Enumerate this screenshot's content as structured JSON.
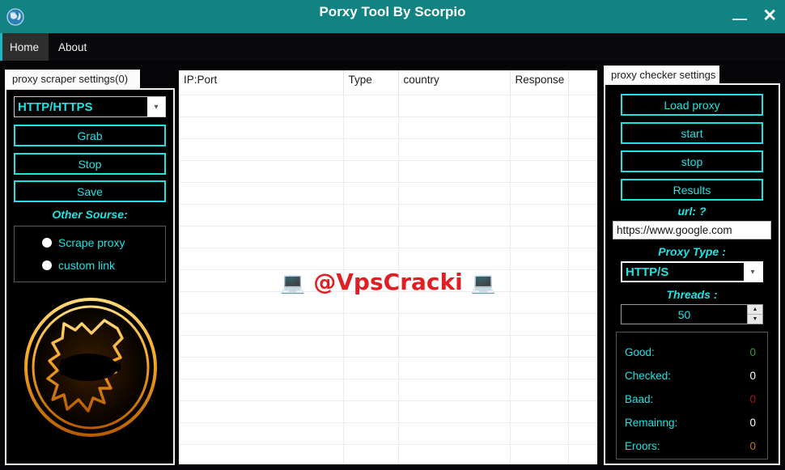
{
  "window": {
    "title": "Porxy Tool By Scorpio",
    "icon": "globe-icon",
    "minimize_label": "—",
    "close_label": "✕",
    "titlebar_color": "#118383"
  },
  "menubar": {
    "items": [
      {
        "label": "Home",
        "active": true
      },
      {
        "label": "About",
        "active": false
      }
    ]
  },
  "scraper_panel": {
    "tab_label": "proxy scraper settings(0)",
    "proxy_type_selected": "HTTP/HTTPS",
    "dropdown_icon": "chevron-down-icon",
    "buttons": [
      {
        "label": "Grab"
      },
      {
        "label": "Stop"
      },
      {
        "label": "Save"
      }
    ],
    "other_source_label": "Other Sourse:",
    "radios": [
      {
        "label": "Scrape proxy"
      },
      {
        "label": "custom link"
      }
    ],
    "logo": "scorpion-logo"
  },
  "table": {
    "columns": [
      "IP:Port",
      "Type",
      "country",
      "Response",
      ""
    ],
    "rows": [],
    "row_count": 17,
    "watermark": "@VpsCracki",
    "watermark_icon": "laptop-icon",
    "watermark_color": "#e01f25"
  },
  "checker_panel": {
    "tab_label": "proxy checker settings",
    "buttons": [
      {
        "label": "Load proxy"
      },
      {
        "label": "start"
      },
      {
        "label": "stop"
      },
      {
        "label": "Results"
      }
    ],
    "url_label": "url: ?",
    "url_value": "https://www.google.com",
    "proxy_type_label": "Proxy Type :",
    "proxy_type_selected": "HTTP/S",
    "dropdown_icon": "chevron-down-icon",
    "threads_label": "Threads :",
    "threads_value": "50",
    "spin_up_icon": "caret-up-icon",
    "spin_down_icon": "caret-down-icon",
    "stats": [
      {
        "label": "Good:",
        "value": "0",
        "color": "#2f9e2f"
      },
      {
        "label": "Checked:",
        "value": "0",
        "color": "#ffffff"
      },
      {
        "label": "Baad:",
        "value": "0",
        "color": "#9e1c1c"
      },
      {
        "label": "Remainng:",
        "value": "0",
        "color": "#ffffff"
      },
      {
        "label": "Eroors:",
        "value": "0",
        "color": "#c4761a"
      }
    ]
  },
  "theme": {
    "accent_cyan": "#1fe3e3",
    "teal": "#118383",
    "background": "#050507"
  }
}
